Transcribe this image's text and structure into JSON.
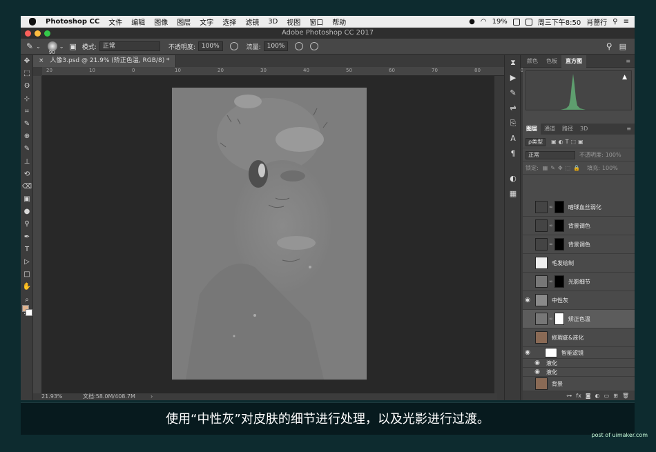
{
  "menubar": {
    "app": "Photoshop CC",
    "items": [
      "文件",
      "编辑",
      "图像",
      "图层",
      "文字",
      "选择",
      "滤镜",
      "3D",
      "视图",
      "窗口",
      "帮助"
    ],
    "battery": "19%",
    "clock": "周三下午8:50",
    "user": "肖蔷行"
  },
  "window": {
    "title": "Adobe Photoshop CC 2017"
  },
  "options": {
    "brush_size": "90",
    "mode_label": "模式:",
    "mode_value": "正常",
    "opacity_label": "不透明度:",
    "opacity_value": "100%",
    "flow_label": "流量:",
    "flow_value": "100%"
  },
  "document_tab": "人像3.psd @ 21.9% (矫正色温, RGB/8) *",
  "ruler_top": [
    "20",
    "10",
    "0",
    "10",
    "20",
    "30",
    "40",
    "50",
    "60",
    "70",
    "80",
    "90"
  ],
  "tools": [
    "✥",
    "⬚",
    "ʘ",
    "⊹",
    "⌗",
    "✎",
    "⊕",
    "✎",
    "⊥",
    "⟲",
    "⌫",
    "▣",
    "●",
    "⚲",
    "✒",
    "T",
    "▷",
    "□",
    "✋",
    "⌕",
    "…"
  ],
  "status": {
    "zoom": "21.93%",
    "doc": "文档:58.0M/408.7M"
  },
  "panel": {
    "tabs": [
      "颜色",
      "色板",
      "直方图"
    ],
    "active_tab": "直方图",
    "layer_tabs": [
      "图层",
      "通道",
      "路径",
      "3D"
    ],
    "active_layer_tab": "图层",
    "filter_label": "ρ类型",
    "blend_mode": "正常",
    "opacity_label": "不透明度:",
    "opacity_value": "100%",
    "lock_label": "锁定:",
    "fill_label": "填充:",
    "fill_value": "100%"
  },
  "layers": [
    {
      "name": "暗球血丝弱化",
      "visible": false
    },
    {
      "name": "背景调色",
      "visible": false
    },
    {
      "name": "背景调色",
      "visible": false
    },
    {
      "name": "毛发绘制",
      "visible": false
    },
    {
      "name": "光影细节",
      "visible": false
    },
    {
      "name": "中性灰",
      "visible": true
    },
    {
      "name": "矫正色温",
      "visible": false,
      "selected": true
    },
    {
      "name": "修瑕疵&液化",
      "visible": false
    },
    {
      "name": "智能滤镜",
      "visible": true
    },
    {
      "name": "液化",
      "visible": true
    },
    {
      "name": "液化",
      "visible": true
    },
    {
      "name": "背景",
      "visible": false
    }
  ],
  "caption": "使用“中性灰”对皮肤的细节进行处理，以及光影进行过渡。",
  "watermark": "post of uimaker.com",
  "colors": {
    "foreground": "#e0b38f",
    "background": "#ffffff",
    "caption_bg": "#071a1e"
  }
}
